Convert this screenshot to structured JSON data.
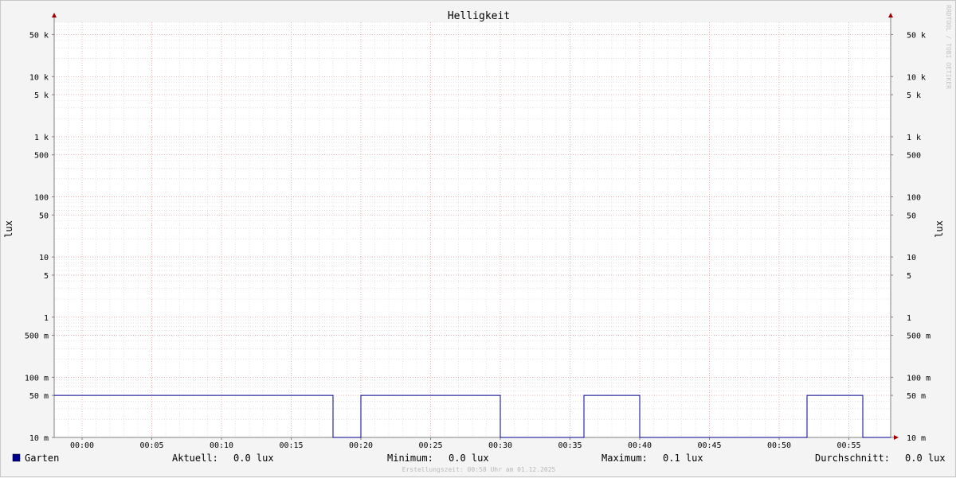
{
  "chart_data": {
    "type": "line",
    "title": "Helligkeit",
    "ylabel": "lux",
    "yscale": "log",
    "ylim": [
      0.01,
      80000
    ],
    "xlim": [
      "23:58",
      "01:58"
    ],
    "x_ticks": [
      "00:00",
      "00:05",
      "00:10",
      "00:15",
      "00:20",
      "00:25",
      "00:30",
      "00:35",
      "00:40",
      "00:45",
      "00:50",
      "00:55"
    ],
    "y_ticks": [
      {
        "value": 50000,
        "label": "50 k"
      },
      {
        "value": 10000,
        "label": "10 k"
      },
      {
        "value": 5000,
        "label": "5 k"
      },
      {
        "value": 1000,
        "label": "1 k"
      },
      {
        "value": 500,
        "label": "500"
      },
      {
        "value": 100,
        "label": "100"
      },
      {
        "value": 50,
        "label": "50"
      },
      {
        "value": 10,
        "label": "10"
      },
      {
        "value": 5,
        "label": "5"
      },
      {
        "value": 1,
        "label": "1"
      },
      {
        "value": 0.5,
        "label": "500 m"
      },
      {
        "value": 0.1,
        "label": "100 m"
      },
      {
        "value": 0.05,
        "label": "50 m"
      },
      {
        "value": 0.01,
        "label": "10 m"
      }
    ],
    "grid": true,
    "series": [
      {
        "name": "Garten",
        "color": "#000090",
        "points": [
          [
            "23:58",
            0.05
          ],
          [
            "00:18",
            0.05
          ],
          [
            "00:18",
            0.01
          ],
          [
            "00:20",
            0.01
          ],
          [
            "00:20",
            0.05
          ],
          [
            "00:30",
            0.05
          ],
          [
            "00:30",
            0.01
          ],
          [
            "00:36",
            0.01
          ],
          [
            "00:36",
            0.05
          ],
          [
            "00:40",
            0.05
          ],
          [
            "00:40",
            0.01
          ],
          [
            "00:52",
            0.01
          ],
          [
            "00:52",
            0.05
          ],
          [
            "00:56",
            0.05
          ],
          [
            "00:56",
            0.01
          ],
          [
            "00:58",
            0.01
          ]
        ]
      }
    ],
    "legend": {
      "current_label": "Aktuell:",
      "current_value": "0.0 lux",
      "min_label": "Minimum:",
      "min_value": "0.0 lux",
      "max_label": "Maximum:",
      "max_value": "0.1 lux",
      "avg_label": "Durchschnitt:",
      "avg_value": "0.0 lux"
    },
    "footer": "Erstellungszeit: 00:58 Uhr am 01.12.2025",
    "watermark": "RRDTOOL / TOBI OETIKER"
  }
}
